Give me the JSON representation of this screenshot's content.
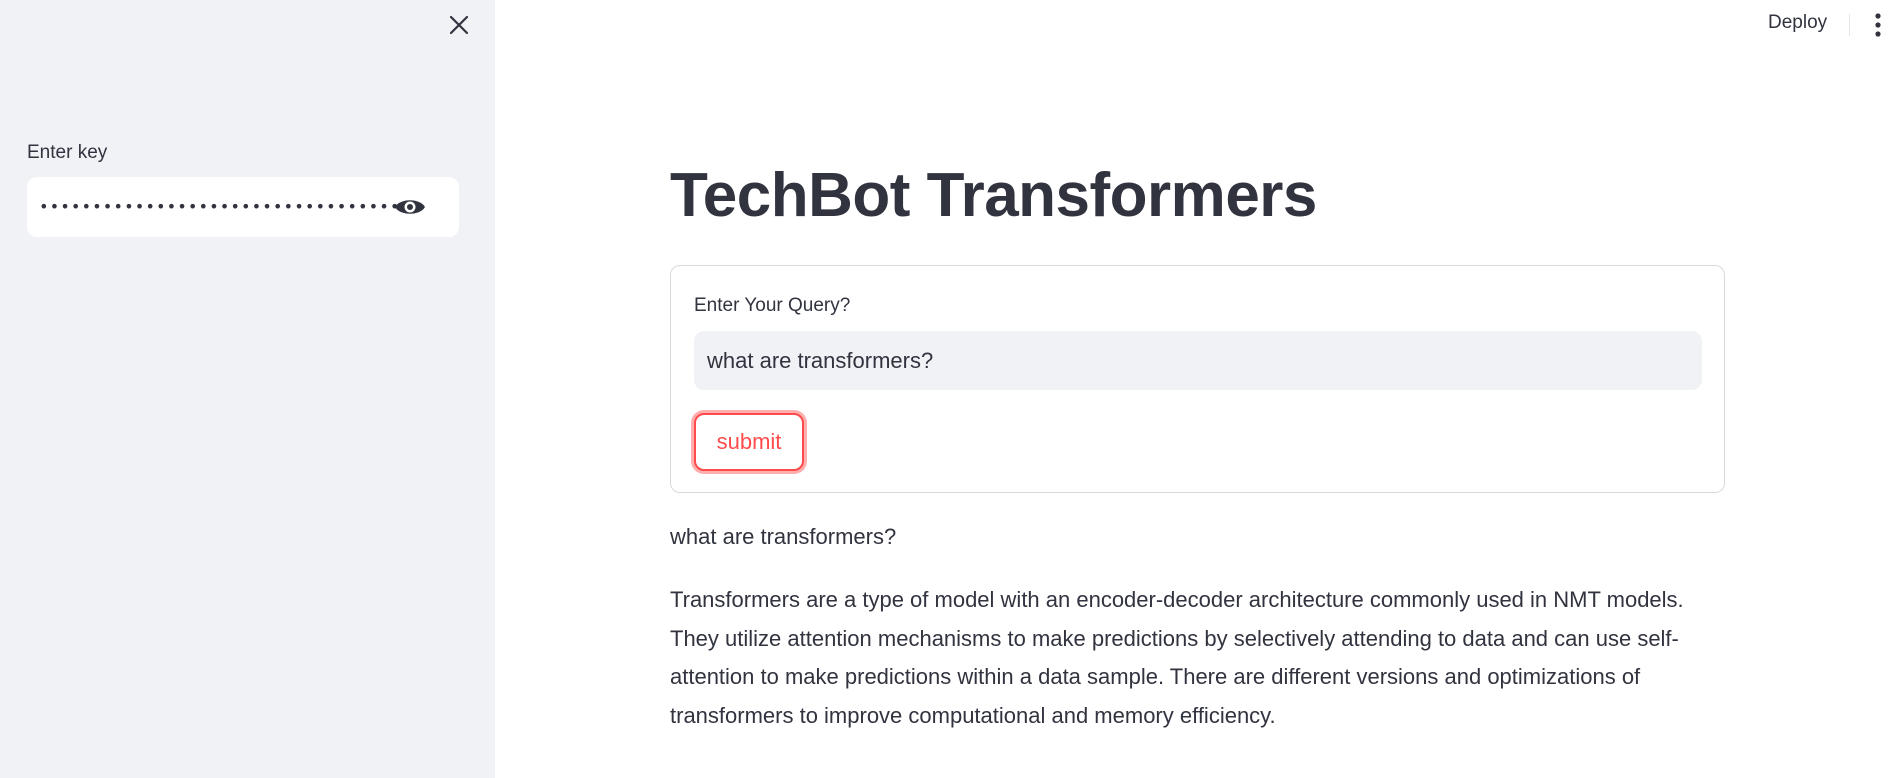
{
  "sidebar": {
    "close_icon": "close-icon",
    "key_label": "Enter key",
    "key_value": "••••••••••••••••••••••••••••••••••••••••••",
    "eye_icon": "eye-icon"
  },
  "header": {
    "deploy_label": "Deploy",
    "menu_icon": "vertical-dots-icon"
  },
  "main": {
    "title": "TechBot Transformers",
    "form": {
      "query_label": "Enter Your Query?",
      "query_value": "what are transformers?",
      "submit_label": "submit"
    },
    "echo_text": "what are transformers?",
    "answer_text": "Transformers are a type of model with an encoder-decoder architecture commonly used in NMT models. They utilize attention mechanisms to make predictions by selectively attending to data and can use self-attention to make predictions within a data sample. There are different versions and optimizations of transformers to improve computational and memory efficiency."
  },
  "colors": {
    "sidebar_bg": "#f0f2f6",
    "text": "#31333f",
    "accent": "#ff4b4b",
    "input_bg": "#f0f2f6",
    "form_border": "#d8dade"
  }
}
